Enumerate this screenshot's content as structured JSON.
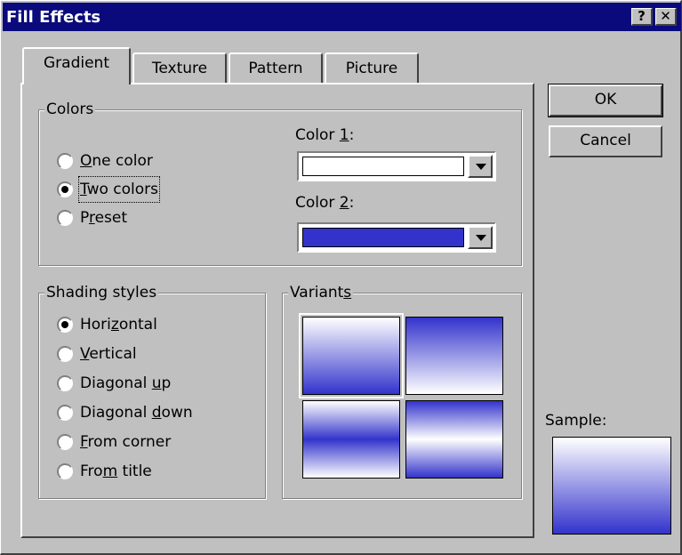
{
  "dialog": {
    "title": "Fill Effects",
    "help_label": "?",
    "close_label": "✕"
  },
  "tabs": [
    {
      "label": "Gradient",
      "active": true
    },
    {
      "label": "Texture",
      "active": false
    },
    {
      "label": "Pattern",
      "active": false
    },
    {
      "label": "Picture",
      "active": false
    }
  ],
  "colors_group": {
    "legend": "Colors",
    "options": [
      {
        "pre": "",
        "key": "O",
        "post": "ne color",
        "selected": false
      },
      {
        "pre": "",
        "key": "T",
        "post": "wo colors",
        "selected": true
      },
      {
        "pre": "P",
        "key": "r",
        "post": "eset",
        "selected": false
      }
    ],
    "color1": {
      "pre": "Color ",
      "key": "1",
      "post": ":",
      "value": "#ffffff"
    },
    "color2": {
      "pre": "Color ",
      "key": "2",
      "post": ":",
      "value": "#3333cc"
    }
  },
  "shading_group": {
    "legend": "Shading styles",
    "options": [
      {
        "pre": "Hori",
        "key": "z",
        "post": "ontal",
        "selected": true
      },
      {
        "pre": "",
        "key": "V",
        "post": "ertical",
        "selected": false
      },
      {
        "pre": "Diagonal ",
        "key": "u",
        "post": "p",
        "selected": false
      },
      {
        "pre": "Diagonal ",
        "key": "d",
        "post": "own",
        "selected": false
      },
      {
        "pre": "",
        "key": "F",
        "post": "rom corner",
        "selected": false
      },
      {
        "pre": "Fro",
        "key": "m",
        "post": " title",
        "selected": false
      }
    ]
  },
  "variants_group": {
    "legend_pre": "Variant",
    "legend_key": "s",
    "legend_post": "",
    "selected_index": 0
  },
  "buttons": {
    "ok": "OK",
    "cancel": "Cancel"
  },
  "sample": {
    "label": "Sample:"
  },
  "colors": {
    "titlebar": "#0a0a7c",
    "face": "#c0c0c0",
    "gradient_blue": "#3333cc",
    "gradient_white": "#ffffff"
  }
}
